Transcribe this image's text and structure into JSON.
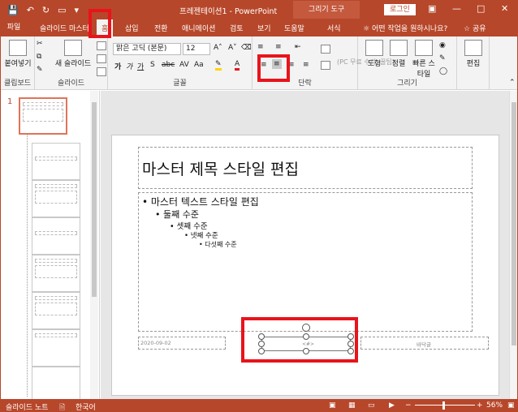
{
  "colors": {
    "accent": "#b7472a",
    "highlight": "#e8131b"
  },
  "titlebar": {
    "qat": [
      "save-icon",
      "undo-icon",
      "redo-icon",
      "present-icon",
      "customize-icon"
    ],
    "document_title": "프레젠테이션1 - PowerPoint",
    "contextual_tool": "그리기 도구",
    "login_label": "로그인",
    "window_controls": [
      "ribbon-display-icon",
      "minimize-icon",
      "restore-icon",
      "close-icon"
    ]
  },
  "tabs": {
    "file": "파일",
    "items": [
      "슬라이드 마스터",
      "홈",
      "삽입",
      "전환",
      "애니메이션",
      "검토",
      "보기",
      "도움말",
      "서식"
    ],
    "active": "홈",
    "tell_me": "어떤 작업을 원하시나요?",
    "share": "공유"
  },
  "ribbon": {
    "clipboard": {
      "paste": "붙여넣기",
      "label": "클립보드"
    },
    "slides": {
      "new_slide": "새 슬라이드",
      "label": "슬라이드"
    },
    "font": {
      "font_name": "맑은 고딕 (본문)",
      "font_size": "12",
      "label": "글꼴",
      "buttons": [
        "가",
        "가",
        "가",
        "S",
        "abc",
        "AV",
        "Aa"
      ]
    },
    "paragraph": {
      "label": "단락"
    },
    "drawing": {
      "shapes": "도형",
      "arrange": "정렬",
      "quick_styles": "빠른 스타일",
      "label": "그리기"
    },
    "editing": {
      "label": "편집"
    },
    "watermark": "(PC 무료 수리, 꿀팁)"
  },
  "thumbnails": {
    "selected_number": "1",
    "count": 8
  },
  "slide": {
    "title": "마스터 제목 스타일 편집",
    "bullets": [
      {
        "text": "• 마스터 텍스트 스타일 편집",
        "level": 1
      },
      {
        "text": "• 둘째 수준",
        "level": 2
      },
      {
        "text": "• 셋째 수준",
        "level": 3
      },
      {
        "text": "• 넷째 수준",
        "level": 4
      },
      {
        "text": "• 다섯째 수준",
        "level": 5
      }
    ],
    "date": "2020-09-02",
    "footer": "바닥글",
    "selected_placeholder_label": "<#>"
  },
  "statusbar": {
    "view_label": "슬라이드 노트",
    "language": "한국어",
    "zoom": "56%"
  }
}
